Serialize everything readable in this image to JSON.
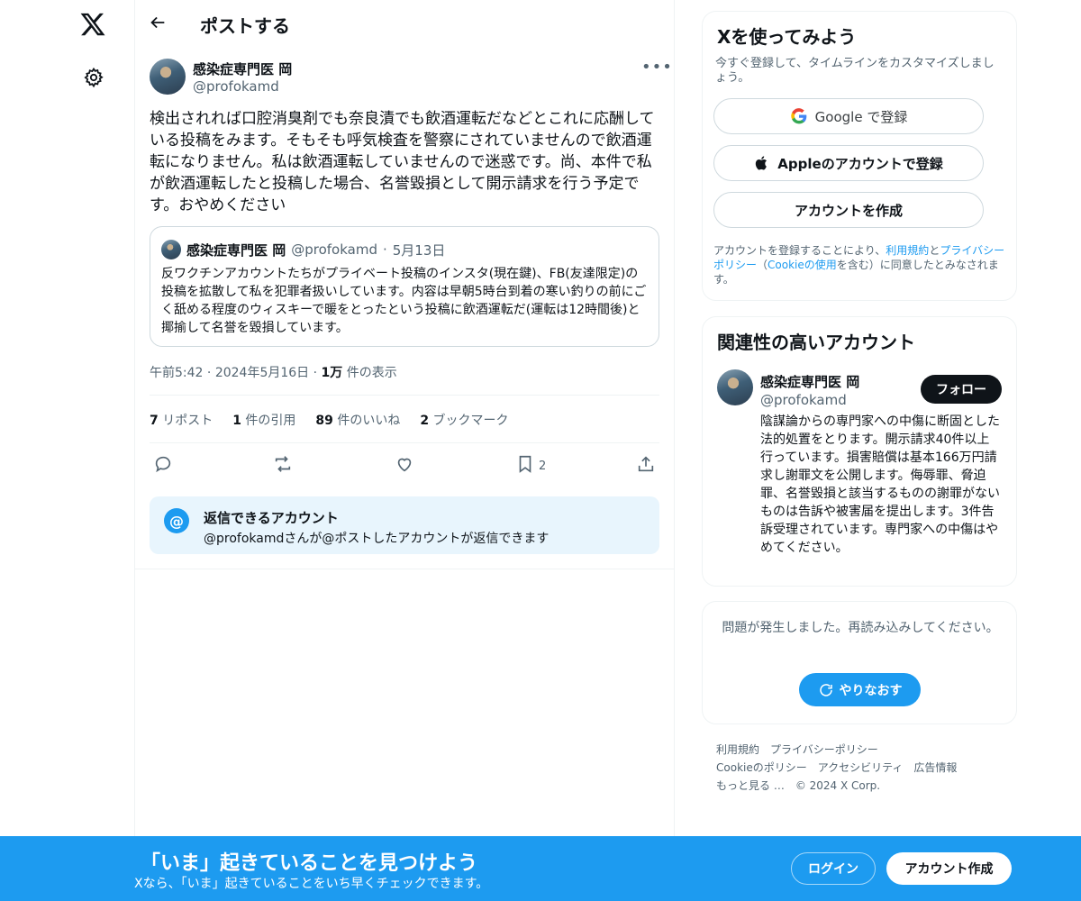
{
  "nav": {
    "logo_icon": "x-logo-icon",
    "settings_icon": "gear-icon"
  },
  "header": {
    "title": "ポストする"
  },
  "post": {
    "name": "感染症専門医 岡",
    "handle": "@profokamd",
    "text": "検出されれば口腔消臭剤でも奈良漬でも飲酒運転だなどとこれに応酬している投稿をみます。そもそも呼気検査を警察にされていませんので飲酒運転になりません。私は飲酒運転していませんので迷惑です。尚、本件で私が飲酒運転したと投稿した場合、名誉毀損として開示請求を行う予定です。おやめください",
    "quote": {
      "name": "感染症専門医 岡",
      "handle": "@profokamd",
      "sep": "·",
      "date": "5月13日",
      "text": "反ワクチンアカウントたちがプライベート投稿のインスタ(現在鍵)、FB(友達限定)の投稿を拡散して私を犯罪者扱いしています。内容は早朝5時台到着の寒い釣りの前にごく舐める程度のウィスキーで暖をとったという投稿に飲酒運転だ(運転は12時間後)と揶揄して名誉を毀損しています。"
    },
    "time": "午前5:42",
    "date": "2024年5月16日",
    "dot": "·",
    "views_count": "1万",
    "views_label": "件の表示",
    "stats": {
      "reposts_count": "7",
      "reposts_label": "リポスト",
      "quotes_count": "1",
      "quotes_label": "件の引用",
      "likes_count": "89",
      "likes_label": "件のいいね",
      "bookmarks_count": "2",
      "bookmarks_label": "ブックマーク"
    },
    "bookmark_action_count": "2",
    "reply_box": {
      "title": "返信できるアカウント",
      "subtitle": "@profokamdさんが@ポストしたアカウントが返信できます",
      "icon": "@"
    }
  },
  "signup_card": {
    "title": "Xを使ってみよう",
    "subtitle": "今すぐ登録して、タイムラインをカスタマイズしましょう。",
    "google_label": "Google で登録",
    "apple_label": "Appleのアカウントで登録",
    "create_label": "アカウントを作成",
    "legal_1": "アカウントを登録することにより、",
    "legal_terms": "利用規約",
    "legal_2": "と",
    "legal_privacy": "プライバシーポリシー",
    "legal_3": "（",
    "legal_cookie": "Cookieの使用",
    "legal_4": "を含む）に同意したとみなされます。"
  },
  "related_card": {
    "title": "関連性の高いアカウント",
    "name": "感染症専門医 岡",
    "handle": "@profokamd",
    "follow_label": "フォロー",
    "bio": "陰謀論からの専門家への中傷に断固とした法的処置をとります。開示請求40件以上行っています。損害賠償は基本166万円請求し謝罪文を公開します。侮辱罪、脅迫罪、名誉毀損と該当するものの謝罪がないものは告訴や被害届を提出します。3件告訴受理されています。専門家への中傷はやめてください。"
  },
  "error_card": {
    "message": "問題が発生しました。再読み込みしてください。",
    "retry_label": "やりなおす"
  },
  "footer": {
    "links": [
      "利用規約",
      "プライバシーポリシー",
      "Cookieのポリシー",
      "アクセシビリティ",
      "広告情報",
      "もっと見る …",
      "© 2024 X Corp."
    ]
  },
  "banner": {
    "title": "「いま」起きていることを見つけよう",
    "subtitle": "Xなら、「いま」起きていることをいち早くチェックできます。",
    "login_label": "ログイン",
    "signup_label": "アカウント作成"
  },
  "colors": {
    "accent": "#1d9bf0",
    "text": "#0f1419",
    "muted": "#536471",
    "reply_bg": "#e8f5fd"
  }
}
